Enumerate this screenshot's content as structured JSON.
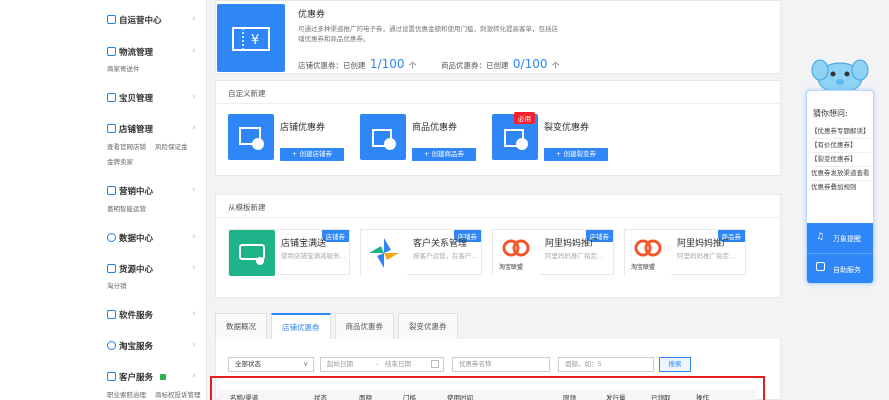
{
  "sidebar": {
    "items": [
      {
        "label": "自运营中心",
        "icon": "shop-icon",
        "subs": []
      },
      {
        "label": "物流管理",
        "icon": "truck-icon",
        "subs": [
          "商家寄送件"
        ]
      },
      {
        "label": "宝贝管理",
        "icon": "bag-icon",
        "subs": []
      },
      {
        "label": "店铺管理",
        "icon": "store-icon",
        "subs": [
          "查看官网店铺",
          "风险保证金",
          "金牌卖家"
        ]
      },
      {
        "label": "营销中心",
        "icon": "megaphone-icon",
        "subs": [
          "葛明智能运营"
        ]
      },
      {
        "label": "数据中心",
        "icon": "chart-icon",
        "subs": []
      },
      {
        "label": "货源中心",
        "icon": "source-icon",
        "subs": [
          "淘分销"
        ]
      },
      {
        "label": "软件服务",
        "icon": "grid-icon",
        "subs": []
      },
      {
        "label": "淘宝服务",
        "icon": "service-icon",
        "subs": []
      },
      {
        "label": "客户服务",
        "icon": "customer-icon",
        "subs": [
          "职业索赔治理",
          "商标权投诉管理"
        ]
      }
    ]
  },
  "header": {
    "title": "优惠券",
    "desc1": "可通过多种渠道推广的电子券，通过设置优惠金额和使用门槛，刺激转化提高客单，包括店",
    "desc2": "铺优惠券和商品优惠券。",
    "store_label": "店铺优惠券：已创建",
    "store_count": "1/100",
    "store_unit": "个",
    "item_label": "商品优惠券：已创建",
    "item_count": "0/100",
    "item_unit": "个"
  },
  "custom": {
    "title": "自定义新建",
    "tiles": [
      {
        "name": "店铺优惠券",
        "button": "+ 创建店铺券",
        "icon": "shop-coupon-icon"
      },
      {
        "name": "商品优惠券",
        "button": "+ 创建商品券",
        "icon": "bag-coupon-icon"
      },
      {
        "name": "裂变优惠券",
        "button": "+ 创建裂变券",
        "icon": "share-coupon-icon",
        "badge": "必用"
      }
    ]
  },
  "templates": {
    "title": "从模板新建",
    "tiles": [
      {
        "name": "店铺宝满送",
        "desc": "使用店铺宝满减服务...",
        "badge": "店铺券",
        "icon": "truck-gift-icon"
      },
      {
        "name": "客户关系管理",
        "desc": "按客户运营，在客户...",
        "badge": "店铺券",
        "icon": "crm-icon"
      },
      {
        "name": "阿里妈妈推广",
        "desc": "阿里妈妈推广指定...",
        "badge": "店铺券",
        "icon": "alimama-icon",
        "brand": "淘宝联盟"
      },
      {
        "name": "阿里妈妈推广",
        "desc": "阿里妈妈推广指定...",
        "badge": "商品券",
        "icon": "alimama-icon",
        "brand": "淘宝联盟"
      }
    ]
  },
  "tabs": [
    "数据概况",
    "店铺优惠券",
    "商品优惠券",
    "裂变优惠券"
  ],
  "filters": {
    "status": "全部状态",
    "start": "起始日期",
    "sep": "-",
    "end": "结束日期",
    "name": "优惠券名称",
    "amount": "面额，如：5",
    "search": "搜索"
  },
  "table_headers": [
    "名称/渠道",
    "状态",
    "面额",
    "门槛",
    "使用时间",
    "限领",
    "发行量",
    "已领取",
    "操作"
  ],
  "helper": {
    "title": "猜你想问:",
    "items": [
      "【优惠券专题解读】",
      "【有价优惠券】",
      "【裂变优惠券】",
      "优惠券发放渠道查看",
      "优惠券叠加规则"
    ],
    "btn1": "万象提醒",
    "btn2": "自助服务"
  },
  "colors": {
    "accent": "#2f86f6",
    "highlight": "#e02020"
  }
}
